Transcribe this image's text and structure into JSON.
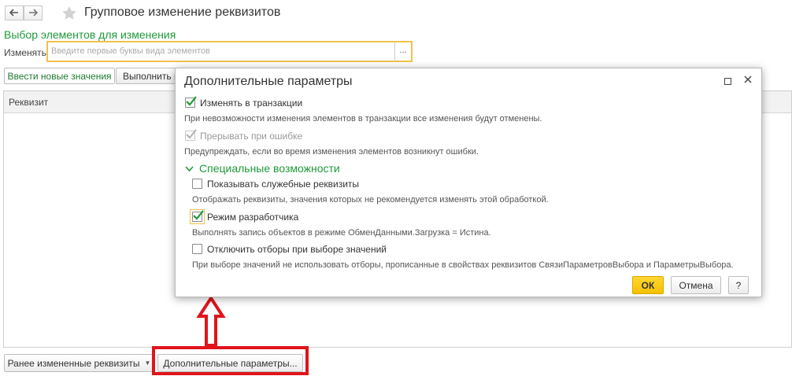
{
  "window": {
    "title": "Групповое изменение реквизитов",
    "back_icon": "arrow-left-icon",
    "forward_icon": "arrow-right-icon",
    "favorite_icon": "star-icon"
  },
  "selection": {
    "section_title": "Выбор элементов для изменения",
    "change_label": "Изменять:",
    "input_placeholder": "Введите первые буквы вида элементов",
    "select_button": "..."
  },
  "toolbar": {
    "enter_new_values": "Ввести новые значения",
    "execute_partial": "Выполнить п"
  },
  "table": {
    "column_requisite": "Реквизит"
  },
  "bottom": {
    "previously_changed": "Ранее измененные реквизиты",
    "additional_params": "Дополнительные параметры..."
  },
  "dialog": {
    "title": "Дополнительные параметры",
    "options": [
      {
        "label": "Изменять в транзакции",
        "checked": true,
        "enabled": true,
        "hint": "При невозможности изменения элементов в транзакции все изменения будут отменены."
      },
      {
        "label": "Прерывать при ошибке",
        "checked": true,
        "enabled": false,
        "hint": "Предупреждать, если во время изменения элементов возникнут ошибки."
      }
    ],
    "special_title": "Специальные возможности",
    "special_options": [
      {
        "label": "Показывать служебные реквизиты",
        "checked": false,
        "hint": "Отображать реквизиты, значения которых не рекомендуется изменять этой обработкой."
      },
      {
        "label": "Режим разработчика",
        "checked": true,
        "hint": "Выполнять запись объектов в режиме ОбменДанными.Загрузка = Истина."
      },
      {
        "label": "Отключить отборы при выборе значений",
        "checked": false,
        "hint": "При выборе значений не использовать отборы, прописанные в свойствах реквизитов СвязиПараметровВыбора и ПараметрыВыбора."
      }
    ],
    "ok": "ОК",
    "cancel": "Отмена",
    "help": "?"
  },
  "colors": {
    "accent_green": "#1e9a3a",
    "ok_yellow": "#f5c200",
    "highlight_red": "#e0141b",
    "input_focus": "#f2c14b"
  }
}
